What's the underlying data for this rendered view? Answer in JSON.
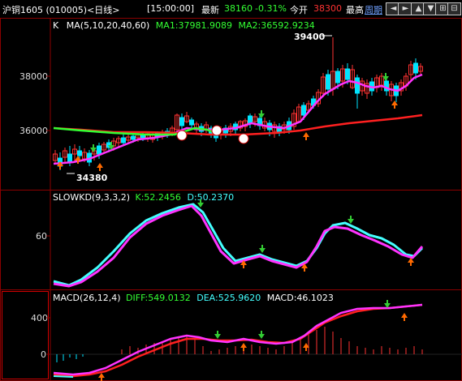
{
  "header": {
    "title": "沪铜1605 (010005)<日线>",
    "time": "[15:00:00]",
    "latest_label": "最新",
    "latest_value": "38160",
    "change_pct": "-0.31%",
    "open_label": "今开",
    "open_value": "38300",
    "high_label": "最高",
    "period_link": "周期",
    "nav_icons": [
      "left-arrow-icon",
      "right-arrow-icon",
      "up-arrow-icon",
      "down-arrow-icon",
      "zoom-in-icon",
      "zoom-out-icon"
    ],
    "nav_glyphs": [
      "◄",
      "►",
      "▲",
      "▼",
      "⊞",
      "⊟"
    ]
  },
  "main_panel": {
    "legend_k": "K",
    "legend_ma": "MA(5,10,20,40,60)",
    "ma1": "MA1:37981.9089",
    "ma2": "MA2:36592.9234",
    "y_labels": [
      "38000",
      "36000"
    ],
    "high_annotation": "39400",
    "low_annotation": "34380",
    "ylim": [
      34000,
      40000
    ]
  },
  "kd_panel": {
    "legend": "SLOWKD(9,3,3,2)",
    "k": "K:52.2456",
    "d": "D:50.2370",
    "y_labels": [
      "60"
    ]
  },
  "macd_panel": {
    "legend": "MACD(26,12,4)",
    "diff": "DIFF:549.0132",
    "dea": "DEA:525.9620",
    "macd": "MACD:46.1023",
    "y_labels": [
      "400",
      "0"
    ]
  },
  "colors": {
    "up": "#ff3232",
    "down": "#00e5ff",
    "ma_magenta": "#ff33ff",
    "ma_red": "#ff2020",
    "ma_green": "#33ff33",
    "kd_cyan": "#44ffff",
    "grid": "#8b0000"
  }
}
